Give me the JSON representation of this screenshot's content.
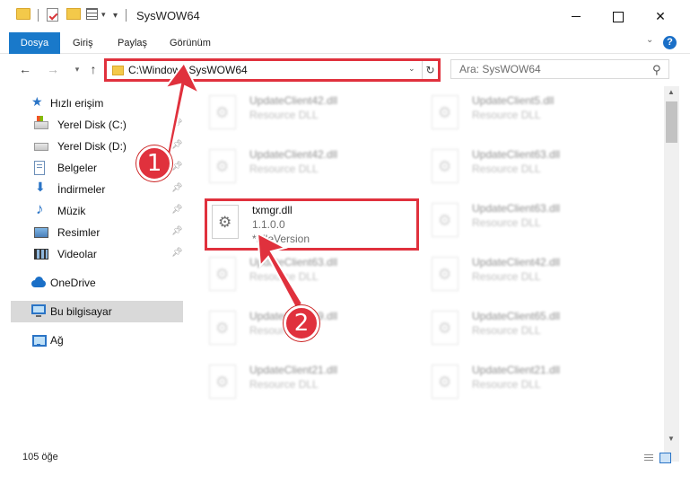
{
  "window": {
    "title": "SysWOW64"
  },
  "ribbon": {
    "tabs": [
      "Dosya",
      "Giriş",
      "Paylaş",
      "Görünüm"
    ],
    "help": "?"
  },
  "address": {
    "path": "C:\\Windows\\SysWOW64",
    "search_placeholder": "Ara: SysWOW64"
  },
  "navpane": {
    "quick_access": "Hızlı erişim",
    "pinned": [
      {
        "label": "Yerel Disk (C:)",
        "icon": "disk-c-icon"
      },
      {
        "label": "Yerel Disk (D:)",
        "icon": "disk-d-icon"
      },
      {
        "label": "Belgeler",
        "icon": "documents-icon"
      },
      {
        "label": "İndirmeler",
        "icon": "downloads-icon"
      },
      {
        "label": "Müzik",
        "icon": "music-icon"
      },
      {
        "label": "Resimler",
        "icon": "pictures-icon"
      },
      {
        "label": "Videolar",
        "icon": "videos-icon"
      }
    ],
    "onedrive": "OneDrive",
    "this_pc": "Bu bilgisayar",
    "network": "Ağ"
  },
  "files": {
    "left": [
      {
        "name": "UpdateClient42.dll",
        "type": "Resource DLL"
      },
      {
        "name": "UpdateClient42.dll",
        "type": "Resource DLL"
      },
      {
        "name": "UpdateClient63.dll",
        "type": "Resource DLL"
      },
      {
        "name": "UpdateClient19.dll",
        "type": "Resource DLL"
      },
      {
        "name": "UpdateClient21.dll",
        "type": "Resource DLL"
      }
    ],
    "right": [
      {
        "name": "UpdateClient5.dll",
        "type": "Resource DLL"
      },
      {
        "name": "UpdateClient63.dll",
        "type": "Resource DLL"
      },
      {
        "name": "UpdateClient63.dll",
        "type": "Resource DLL"
      },
      {
        "name": "UpdateClient42.dll",
        "type": "Resource DLL"
      },
      {
        "name": "UpdateClient65.dll",
        "type": "Resource DLL"
      },
      {
        "name": "UpdateClient21.dll",
        "type": "Resource DLL"
      }
    ],
    "highlighted": {
      "name": "txmgr.dll",
      "version": "1.1.0.0",
      "description": "*FileVersion"
    }
  },
  "status": {
    "count": "105 öğe"
  },
  "annotations": {
    "step1": "1",
    "step2": "2",
    "color": "#e0313d"
  }
}
